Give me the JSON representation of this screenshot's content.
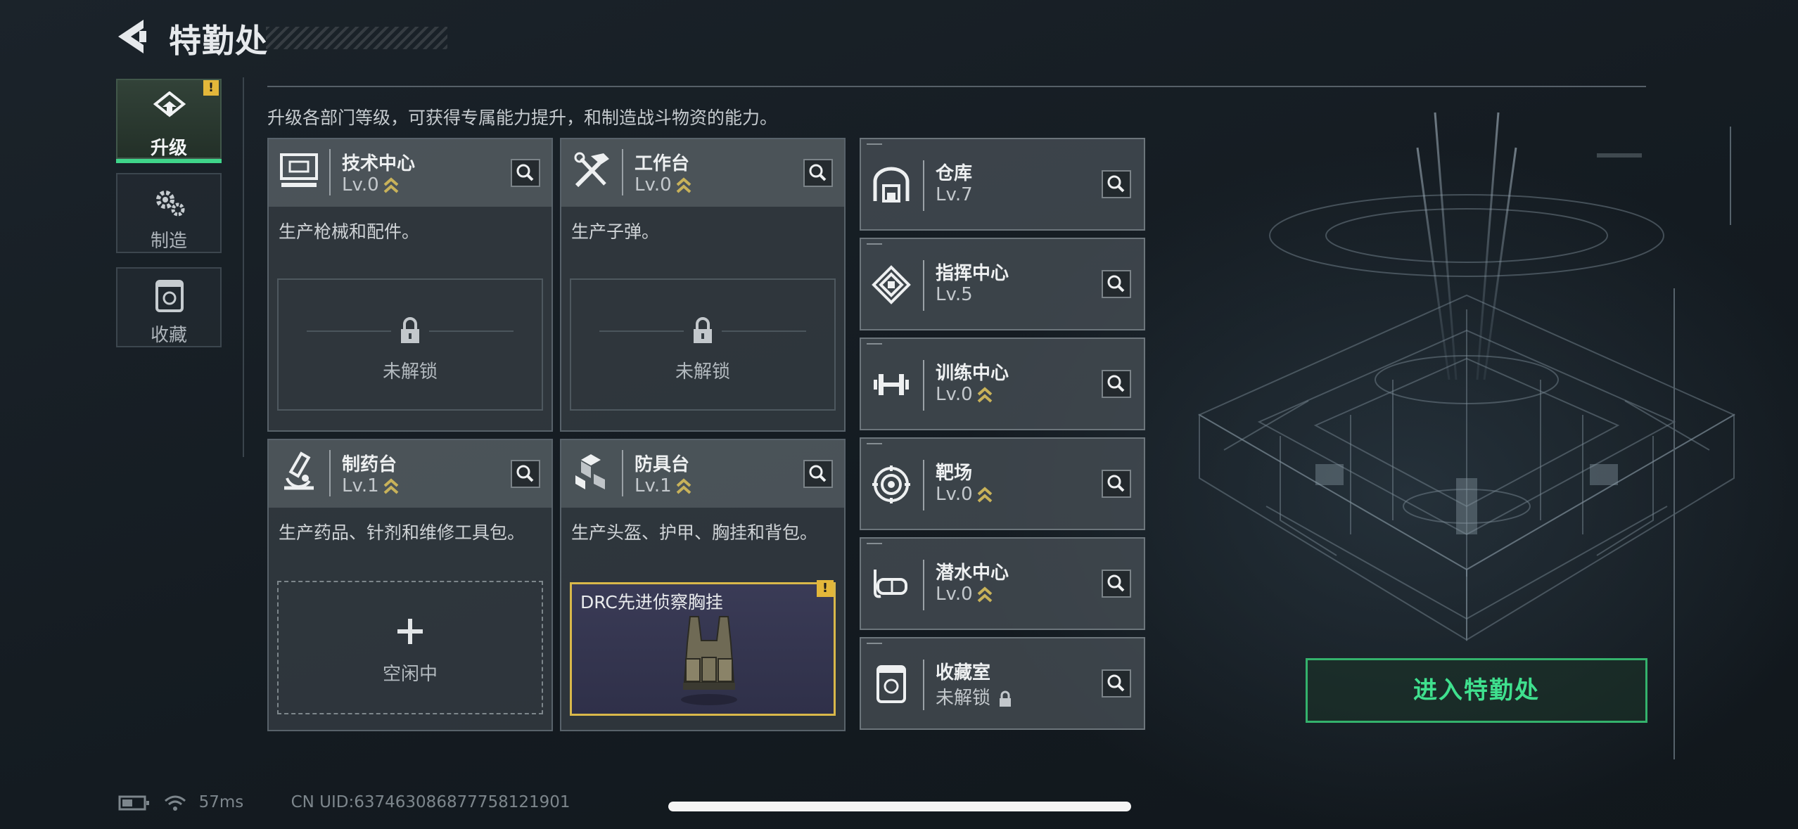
{
  "header": {
    "title": "特勤处"
  },
  "tabs": [
    {
      "label": "升级",
      "icon": "upgrade-icon",
      "active": true,
      "badge": "!"
    },
    {
      "label": "制造",
      "icon": "gears-icon",
      "active": false
    },
    {
      "label": "收藏",
      "icon": "collection-icon",
      "active": false
    }
  ],
  "intro": "升级各部门等级，可获得专属能力提升，和制造战斗物资的能力。",
  "cards": [
    {
      "name": "技术中心",
      "level": "Lv.0",
      "desc": "生产枪械和配件。",
      "slot": "未解锁",
      "icon": "tech-center-icon"
    },
    {
      "name": "工作台",
      "level": "Lv.0",
      "desc": "生产子弹。",
      "slot": "未解锁",
      "icon": "workbench-icon"
    },
    {
      "name": "制药台",
      "level": "Lv.1",
      "desc": "生产药品、针剂和维修工具包。",
      "slot": "空闲中",
      "icon": "microscope-icon"
    },
    {
      "name": "防具台",
      "level": "Lv.1",
      "desc": "生产头盔、护甲、胸挂和背包。",
      "slot_item": "DRC先进侦察胸挂",
      "icon": "armor-icon",
      "badge": "!"
    }
  ],
  "departments": [
    {
      "name": "仓库",
      "level": "Lv.7",
      "icon": "warehouse-icon"
    },
    {
      "name": "指挥中心",
      "level": "Lv.5",
      "icon": "command-icon"
    },
    {
      "name": "训练中心",
      "level": "Lv.0",
      "icon": "dumbbell-icon"
    },
    {
      "name": "靶场",
      "level": "Lv.0",
      "icon": "target-icon"
    },
    {
      "name": "潜水中心",
      "level": "Lv.0",
      "icon": "diving-mask-icon"
    },
    {
      "name": "收藏室",
      "level": "未解锁",
      "icon": "collection-room-icon"
    }
  ],
  "enter_button": "进入特勤处",
  "status": {
    "ping": "57ms",
    "uid": "CN UID:637463086877758121901"
  },
  "colors": {
    "accent_green": "#3fe08e",
    "badge_yellow": "#e3b73a",
    "level_chevron": "#c8b25a"
  }
}
